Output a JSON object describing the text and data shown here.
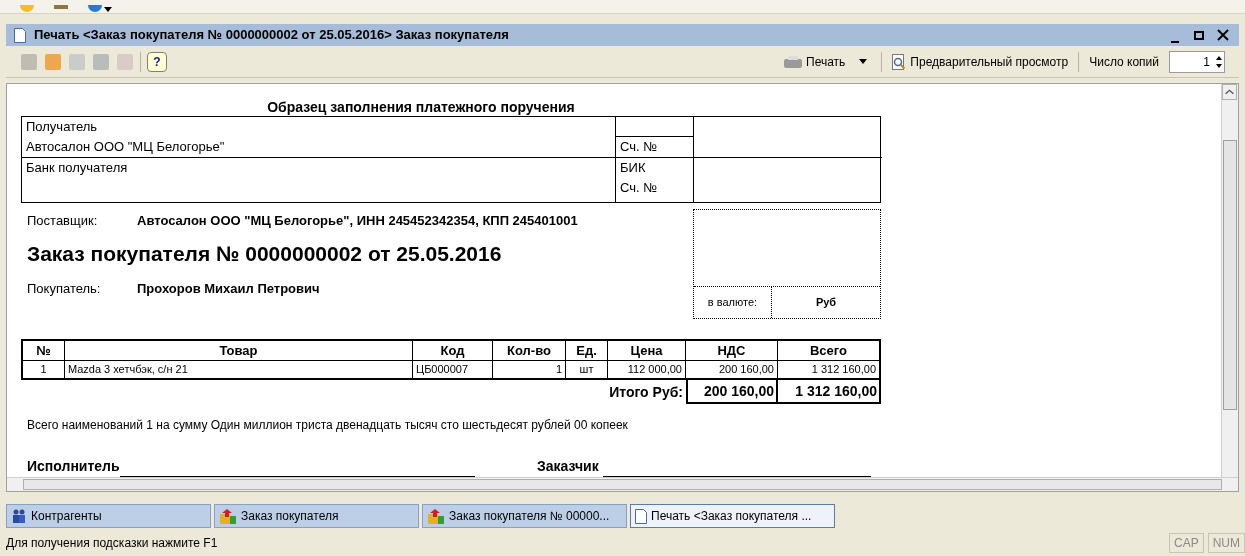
{
  "window": {
    "title": "Печать <Заказ покупателя № 0000000002 от 25.05.2016> Заказ покупателя"
  },
  "toolbar": {
    "help": "?",
    "print": "Печать",
    "preview": "Предварительный просмотр",
    "copies_label": "Число копий",
    "copies": "1"
  },
  "document": {
    "heading": "Образец заполнения платежного поручения",
    "payment": {
      "recipient_label": "Получатель",
      "recipient": "Автосалон ООО \"МЦ Белогорье\"",
      "account_label": "Сч. №",
      "bank_label": "Банк получателя",
      "bik_label": "БИК",
      "bank_account_label": "Сч. №"
    },
    "supplier_label": "Поставщик:",
    "supplier": "Автосалон ООО \"МЦ Белогорье\", ИНН 245452342354, КПП 245401001",
    "order_title": "Заказ покупателя № 0000000002 от 25.05.2016",
    "buyer_label": "Покупатель:",
    "buyer": "Прохоров Михаил Петрович",
    "currency_label": "в валюте:",
    "currency": "Руб",
    "columns": [
      "№",
      "Товар",
      "Код",
      "Кол-во",
      "Ед.",
      "Цена",
      "НДС",
      "Всего"
    ],
    "rows": [
      [
        "1",
        "Mazda 3 хетчбэк, с/н 21",
        "ЦБ000007",
        "1",
        "шт",
        "112 000,00",
        "200 160,00",
        "1 312 160,00"
      ]
    ],
    "totals_label": "Итого Руб:",
    "totals_vat": "200 160,00",
    "totals_sum": "1 312 160,00",
    "summary": "Всего наименований 1 на сумму Один миллион триста двенадцать тысяч сто шестьдесят рублей 00 копеек",
    "signatures": [
      "Исполнитель",
      "Заказчик"
    ]
  },
  "taskbar": [
    {
      "label": "Контрагенты",
      "kind": "people",
      "selected": false
    },
    {
      "label": "Заказ покупателя",
      "kind": "order",
      "selected": false
    },
    {
      "label": "Заказ покупателя № 00000...",
      "kind": "order",
      "selected": false
    },
    {
      "label": "Печать <Заказ покупателя ...",
      "kind": "page",
      "selected": true
    }
  ],
  "status_bar": {
    "hint": "Для получения подсказки нажмите F1",
    "indicators": [
      "CAP",
      "NUM"
    ]
  }
}
